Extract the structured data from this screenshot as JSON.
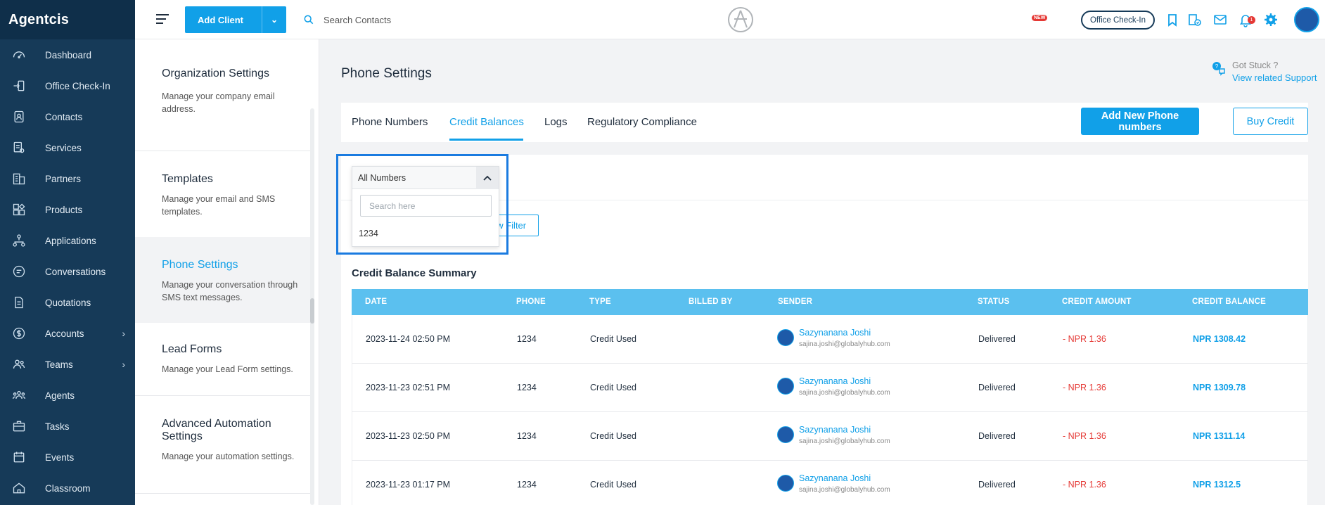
{
  "app": {
    "brand": "Agentcis"
  },
  "sidebar": {
    "items": [
      {
        "label": "Dashboard",
        "icon": "gauge-icon"
      },
      {
        "label": "Office Check-In",
        "icon": "check-in-icon"
      },
      {
        "label": "Contacts",
        "icon": "contacts-icon"
      },
      {
        "label": "Services",
        "icon": "services-icon"
      },
      {
        "label": "Partners",
        "icon": "building-icon"
      },
      {
        "label": "Products",
        "icon": "products-icon"
      },
      {
        "label": "Applications",
        "icon": "flow-icon"
      },
      {
        "label": "Conversations",
        "icon": "chat-icon"
      },
      {
        "label": "Quotations",
        "icon": "document-icon"
      },
      {
        "label": "Accounts",
        "icon": "dollar-icon",
        "chevron": "›"
      },
      {
        "label": "Teams",
        "icon": "team-icon",
        "chevron": "›"
      },
      {
        "label": "Agents",
        "icon": "agents-icon"
      },
      {
        "label": "Tasks",
        "icon": "briefcase-icon"
      },
      {
        "label": "Events",
        "icon": "calendar-icon"
      },
      {
        "label": "Classroom",
        "icon": "classroom-icon"
      }
    ]
  },
  "topbar": {
    "add_client_label": "Add Client",
    "search_placeholder": "Search Contacts",
    "office_checkin_label": "Office Check-In",
    "new_badge": "NEW",
    "notification_count": "1"
  },
  "settings_menu": {
    "items": [
      {
        "title": "Organization Settings",
        "desc": "Manage your company email address."
      },
      {
        "title": "Templates",
        "desc": "Manage your email and SMS templates."
      },
      {
        "title": "Phone Settings",
        "desc": "Manage your conversation through SMS text messages.",
        "active": true
      },
      {
        "title": "Lead Forms",
        "desc": "Manage your Lead Form settings."
      },
      {
        "title": "Advanced Automation Settings",
        "desc": "Manage your automation settings."
      }
    ]
  },
  "page": {
    "title": "Phone Settings",
    "help_text": "Got Stuck ?",
    "help_link": "View related Support"
  },
  "tabs": [
    {
      "label": "Phone Numbers"
    },
    {
      "label": "Credit Balances",
      "active": true
    },
    {
      "label": "Logs"
    },
    {
      "label": "Regulatory Compliance"
    }
  ],
  "actions": {
    "add_phone_label": "Add New Phone numbers",
    "buy_credit_label": "Buy Credit",
    "view_filter_label": "ew Filter"
  },
  "number_dropdown": {
    "selected": "All Numbers",
    "search_placeholder": "Search here",
    "options": [
      "1234"
    ]
  },
  "summary": {
    "title": "Credit Balance Summary",
    "columns": [
      "Date",
      "Phone",
      "Type",
      "Billed By",
      "Sender",
      "Status",
      "Credit Amount",
      "Credit Balance"
    ],
    "rows": [
      {
        "date": "2023-11-24 02:50 PM",
        "phone": "1234",
        "type": "Credit Used",
        "billed_by": "",
        "sender_name": "Sazynanana Joshi",
        "sender_email": "sajina.joshi@globalyhub.com",
        "status": "Delivered",
        "amount": "- NPR 1.36",
        "balance": "NPR 1308.42"
      },
      {
        "date": "2023-11-23 02:51 PM",
        "phone": "1234",
        "type": "Credit Used",
        "billed_by": "",
        "sender_name": "Sazynanana Joshi",
        "sender_email": "sajina.joshi@globalyhub.com",
        "status": "Delivered",
        "amount": "- NPR 1.36",
        "balance": "NPR 1309.78"
      },
      {
        "date": "2023-11-23 02:50 PM",
        "phone": "1234",
        "type": "Credit Used",
        "billed_by": "",
        "sender_name": "Sazynanana Joshi",
        "sender_email": "sajina.joshi@globalyhub.com",
        "status": "Delivered",
        "amount": "- NPR 1.36",
        "balance": "NPR 1311.14"
      },
      {
        "date": "2023-11-23 01:17 PM",
        "phone": "1234",
        "type": "Credit Used",
        "billed_by": "",
        "sender_name": "Sazynanana Joshi",
        "sender_email": "sajina.joshi@globalyhub.com",
        "status": "Delivered",
        "amount": "- NPR 1.36",
        "balance": "NPR 1312.5"
      }
    ]
  },
  "colors": {
    "sidebar": "#163a58",
    "accent": "#11a0e8",
    "table_header": "#5bc0ef",
    "negative": "#e53935"
  }
}
